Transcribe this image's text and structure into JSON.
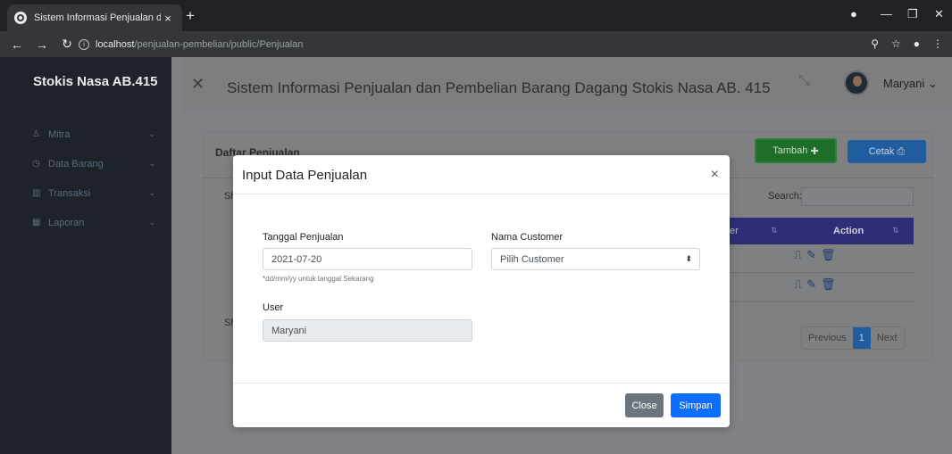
{
  "browser": {
    "tab_title": "Sistem Informasi Penjualan dan P",
    "tab_close": "×",
    "new_tab": "+",
    "url_host": "localhost",
    "url_path": "/penjualan-pembelian/public/Penjualan"
  },
  "sidebar": {
    "brand": "Stokis Nasa AB.415",
    "items": [
      {
        "label": "Mitra",
        "icon": "user-icon"
      },
      {
        "label": "Data Barang",
        "icon": "box-icon"
      },
      {
        "label": "Transaksi",
        "icon": "chart-icon"
      },
      {
        "label": "Laporan",
        "icon": "calendar-icon"
      }
    ]
  },
  "header": {
    "title": "Sistem Informasi Penjualan dan Pembelian Barang Dagang Stokis Nasa AB. 415",
    "username": "Maryani"
  },
  "card": {
    "title": "Daftar Penjualan",
    "add_label": "Tambah",
    "print_label": "Cetak",
    "search_label": "Search:",
    "col_partial": "er",
    "col_action": "Action",
    "show_partial": "Sh",
    "show_partial2": "Sh",
    "pagination": {
      "previous": "Previous",
      "current": "1",
      "next": "Next"
    }
  },
  "modal": {
    "title": "Input Data Penjualan",
    "close_x": "×",
    "tanggal_label": "Tanggal Penjualan",
    "tanggal_value": "2021-07-20",
    "tanggal_hint": "*dd/mm/yy untuk tanggal Sekarang",
    "customer_label": "Nama Customer",
    "customer_value": "Pilih Customer",
    "user_label": "User",
    "user_value": "Maryani",
    "close_button": "Close",
    "save_button": "Simpan"
  }
}
